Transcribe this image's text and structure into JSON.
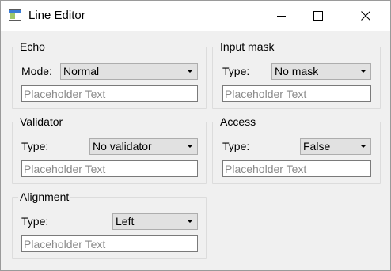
{
  "window": {
    "title": "Line Editor",
    "app_icon": "qt-window-icon",
    "controls": {
      "minimize_icon": "minimize-icon",
      "maximize_icon": "maximize-icon",
      "close_icon": "close-icon"
    }
  },
  "groups": {
    "echo": {
      "title": "Echo",
      "label": "Mode:",
      "selected": "Normal",
      "placeholder": "Placeholder Text"
    },
    "input_mask": {
      "title": "Input mask",
      "label": "Type:",
      "selected": "No mask",
      "placeholder": "Placeholder Text"
    },
    "validator": {
      "title": "Validator",
      "label": "Type:",
      "selected": "No validator",
      "placeholder": "Placeholder Text"
    },
    "access": {
      "title": "Access",
      "label": "Type:",
      "selected": "False",
      "placeholder": "Placeholder Text"
    },
    "alignment": {
      "title": "Alignment",
      "label": "Type:",
      "selected": "Left",
      "placeholder": "Placeholder Text"
    }
  },
  "colors": {
    "window_bg": "#f0f0f0",
    "titlebar_bg": "#ffffff",
    "combo_bg": "#e1e1e1",
    "placeholder_text": "#8a8a8a"
  }
}
